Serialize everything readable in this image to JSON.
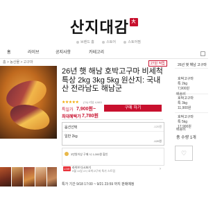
{
  "header": {
    "logo_text": "산지대감",
    "seal_text": "大監",
    "sub_links": [
      "브랜드 홈",
      "스토어",
      "스토어찜"
    ],
    "nav": [
      "홈",
      "라이브",
      "공지사항",
      "카테고리"
    ],
    "breadcrumb": "홈 > 농산물 > 고구마"
  },
  "product": {
    "badge": "27원 적립",
    "title": "26년 햇 해남 호박고구마 비세척 특상 2kg 3kg 5kg 원산지: 국내산 전라남도 해남군",
    "stars": "★★★★★",
    "rating_text": "(74) 리뷰 4,983",
    "sale_label": "특일가",
    "sale_price": "7,900원~",
    "buy_label": "구매 하기",
    "max_label": "최대혜택가",
    "max_price": "7,780원",
    "options": {
      "header": "옵션선택",
      "weight_note": "-120원",
      "first": "일반 2kg",
      "first_price": "-120원"
    },
    "coupon_text": "3만원이상 구매 시 1,000원 할인",
    "live_badge": "LIVE",
    "live_line1": "라이브 다시보기",
    "live_line2": "9월 11일 2시 호박고구마 특가 스트림",
    "period": "특가 기간 9/18 17:00 ~ 9/21 23:59 까지 판매예정"
  },
  "side_panel": {
    "title": "26년 햇 해남 고구마",
    "items": [
      {
        "name": "호박고구마",
        "size": "특 2kg",
        "price": "7,900원"
      },
      {
        "name": "호박고구마",
        "size": "특 3kg",
        "price": "11,900원"
      },
      {
        "name": "호박고구마",
        "size": "특 5kg",
        "price": "17,900원"
      }
    ],
    "label_a": "배송비",
    "label_b": "배송비",
    "total_label": "총 수량 1개",
    "wish_icon": "heart-icon"
  }
}
